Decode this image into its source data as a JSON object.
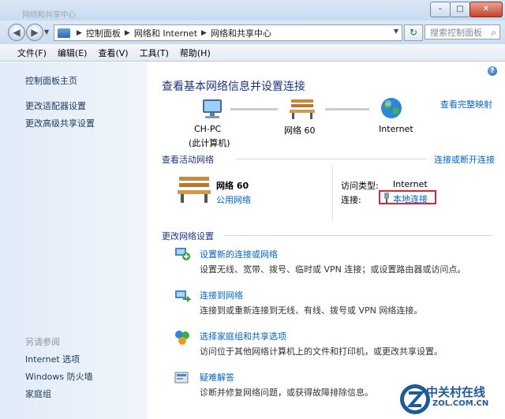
{
  "window": {
    "title": "网络和共享中心",
    "minimize_glyph": "–",
    "maximize_glyph": "□",
    "close_glyph": "✕"
  },
  "address": {
    "breadcrumbs": [
      "控制面板",
      "网络和 Internet",
      "网络和共享中心"
    ],
    "search_placeholder": "搜索控制面板"
  },
  "menu": [
    "文件(F)",
    "编辑(E)",
    "查看(V)",
    "工具(T)",
    "帮助(H)"
  ],
  "sidebar": {
    "links": [
      "控制面板主页",
      "更改适配器设置",
      "更改高级共享设置"
    ],
    "see_also_label": "另请参阅",
    "see_also": [
      "Internet 选项",
      "Windows 防火墙",
      "家庭组"
    ]
  },
  "main": {
    "title": "查看基本网络信息并设置连接",
    "full_map_link": "查看完整映射",
    "map": {
      "computer_name": "CH-PC",
      "computer_sub": "(此计算机)",
      "network_name": "网络 60",
      "internet_label": "Internet"
    },
    "active": {
      "section_title": "查看活动网络",
      "connect_link": "连接或断开连接",
      "network_name": "网络  60",
      "network_type": "公用网络",
      "access_type_label": "访问类型:",
      "access_type_value": "Internet",
      "connections_label": "连接:",
      "connection_link": "本地连接"
    },
    "change_section_title": "更改网络设置",
    "tasks": [
      {
        "title": "设置新的连接或网络",
        "desc": "设置无线、宽带、拨号、临时或 VPN 连接；或设置路由器或访问点。"
      },
      {
        "title": "连接到网络",
        "desc": "连接到或重新连接到无线、有线、拨号或 VPN 网络连接。"
      },
      {
        "title": "选择家庭组和共享选项",
        "desc": "访问位于其他网络计算机上的文件和打印机，或更改共享设置。"
      },
      {
        "title": "疑难解答",
        "desc": "诊断并修复网络问题，或获得故障排除信息。"
      }
    ]
  },
  "watermark": {
    "title": "中关村在线",
    "subtitle": "ZOL.COM.CN"
  }
}
